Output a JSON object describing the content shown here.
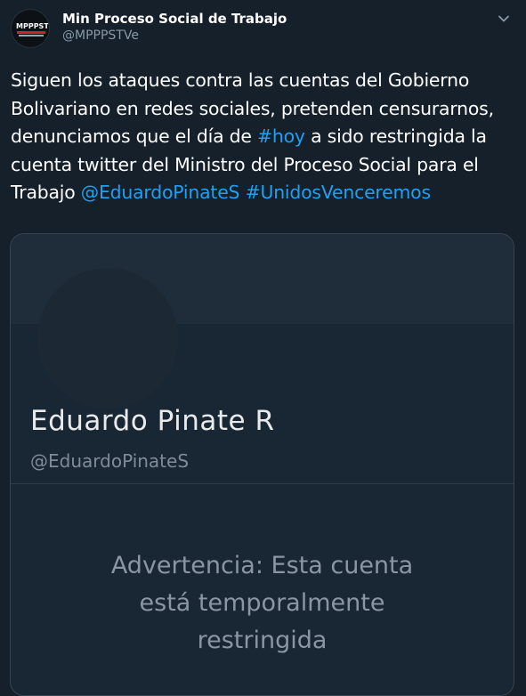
{
  "author": {
    "name": "Min Proceso Social de Trabajo",
    "handle": "@MPPPSTVe",
    "avatar_text": "MPPPST"
  },
  "tweet": {
    "segments": [
      {
        "text": "Siguen los ataques contra las cuentas del Gobierno Bolivariano en redes sociales, pretenden censurarnos, denunciamos que el día de  ",
        "type": "text"
      },
      {
        "text": "#hoy",
        "type": "hashtag"
      },
      {
        "text": " a sido restringida la cuenta twitter del Ministro del Proceso Social para el Trabajo ",
        "type": "text"
      },
      {
        "text": "@EduardoPinateS",
        "type": "mention"
      },
      {
        "text": " ",
        "type": "text"
      },
      {
        "text": "#UnidosVenceremos",
        "type": "hashtag"
      }
    ]
  },
  "media": {
    "profile_name": "Eduardo Pinate R",
    "profile_handle": "@EduardoPinateS",
    "warning_lines": [
      "Advertencia: Esta cuenta",
      "está temporalmente",
      "restringida"
    ]
  },
  "colors": {
    "background": "#15202b",
    "link": "#1da1f2",
    "muted": "#8899a6"
  },
  "icons": {
    "menu": "chevron-down-icon"
  }
}
